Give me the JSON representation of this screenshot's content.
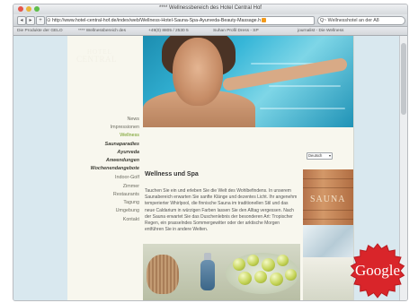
{
  "browser": {
    "window_title": "**** Wellnessbereich des Hotel Central Hof",
    "back_icon": "back-arrow-icon",
    "forward_icon": "forward-arrow-icon",
    "url": "http://www.hotel-central-hof.de/index/web/Wellness-Hotel-Sauna-Spa-Ayurveda-Beauty-Massage.h",
    "search_value": "Q~ Wellnesshotel an der A8",
    "bookmarks": [
      "Die Produkte der GELO",
      "**** Wellnessbereich des",
      "+49(0) 8805 / 2530 5",
      "Suhan Profil Dress - SP",
      "journalist - Die Wellness"
    ]
  },
  "site": {
    "logo_top": "HOTEL",
    "logo_main": "CENTRAL",
    "nav": [
      {
        "label": "News"
      },
      {
        "label": "Impressionen"
      },
      {
        "label": "Wellness",
        "active": true
      },
      {
        "label": "Saunaparadies"
      },
      {
        "label": "Ayurveda",
        "emphasis": true
      },
      {
        "label": "Anwendungen"
      },
      {
        "label": "Wochenendangebote"
      },
      {
        "label": "Indoor-Golf"
      },
      {
        "label": "Zimmer"
      },
      {
        "label": "Restaurants"
      },
      {
        "label": "Tagung"
      },
      {
        "label": "Umgebung"
      },
      {
        "label": "Kontakt"
      }
    ],
    "language_select": "Deutsch",
    "heading": "Wellness und Spa",
    "body_text": "Tauchen Sie ein und erleben Sie die Welt des Wohlbefindens. In unserem Saunabereich erwarten Sie sanfte Klänge und dezentes Licht. Ihr angenehm temperierter Whirlpool, die finnische Sauna im traditionellen Stil und das neue Caldarium in würzigen Farben lassen Sie den Alltag vergessen. Nach der Sauna erwartet Sie das Duschenlebnis der besonderen Art: Tropischer Regen, ein prasselndes Sommergewitter oder der arktische Morgen entführen Sie in andere Welten.",
    "sauna_sign": "SAUNA"
  },
  "badge": {
    "label": "Google",
    "color": "#d9252a"
  },
  "colors": {
    "nav_active": "#6e9a1d",
    "page_bg": "#f8f7ee",
    "sky_bg": "#d9e8ef"
  }
}
